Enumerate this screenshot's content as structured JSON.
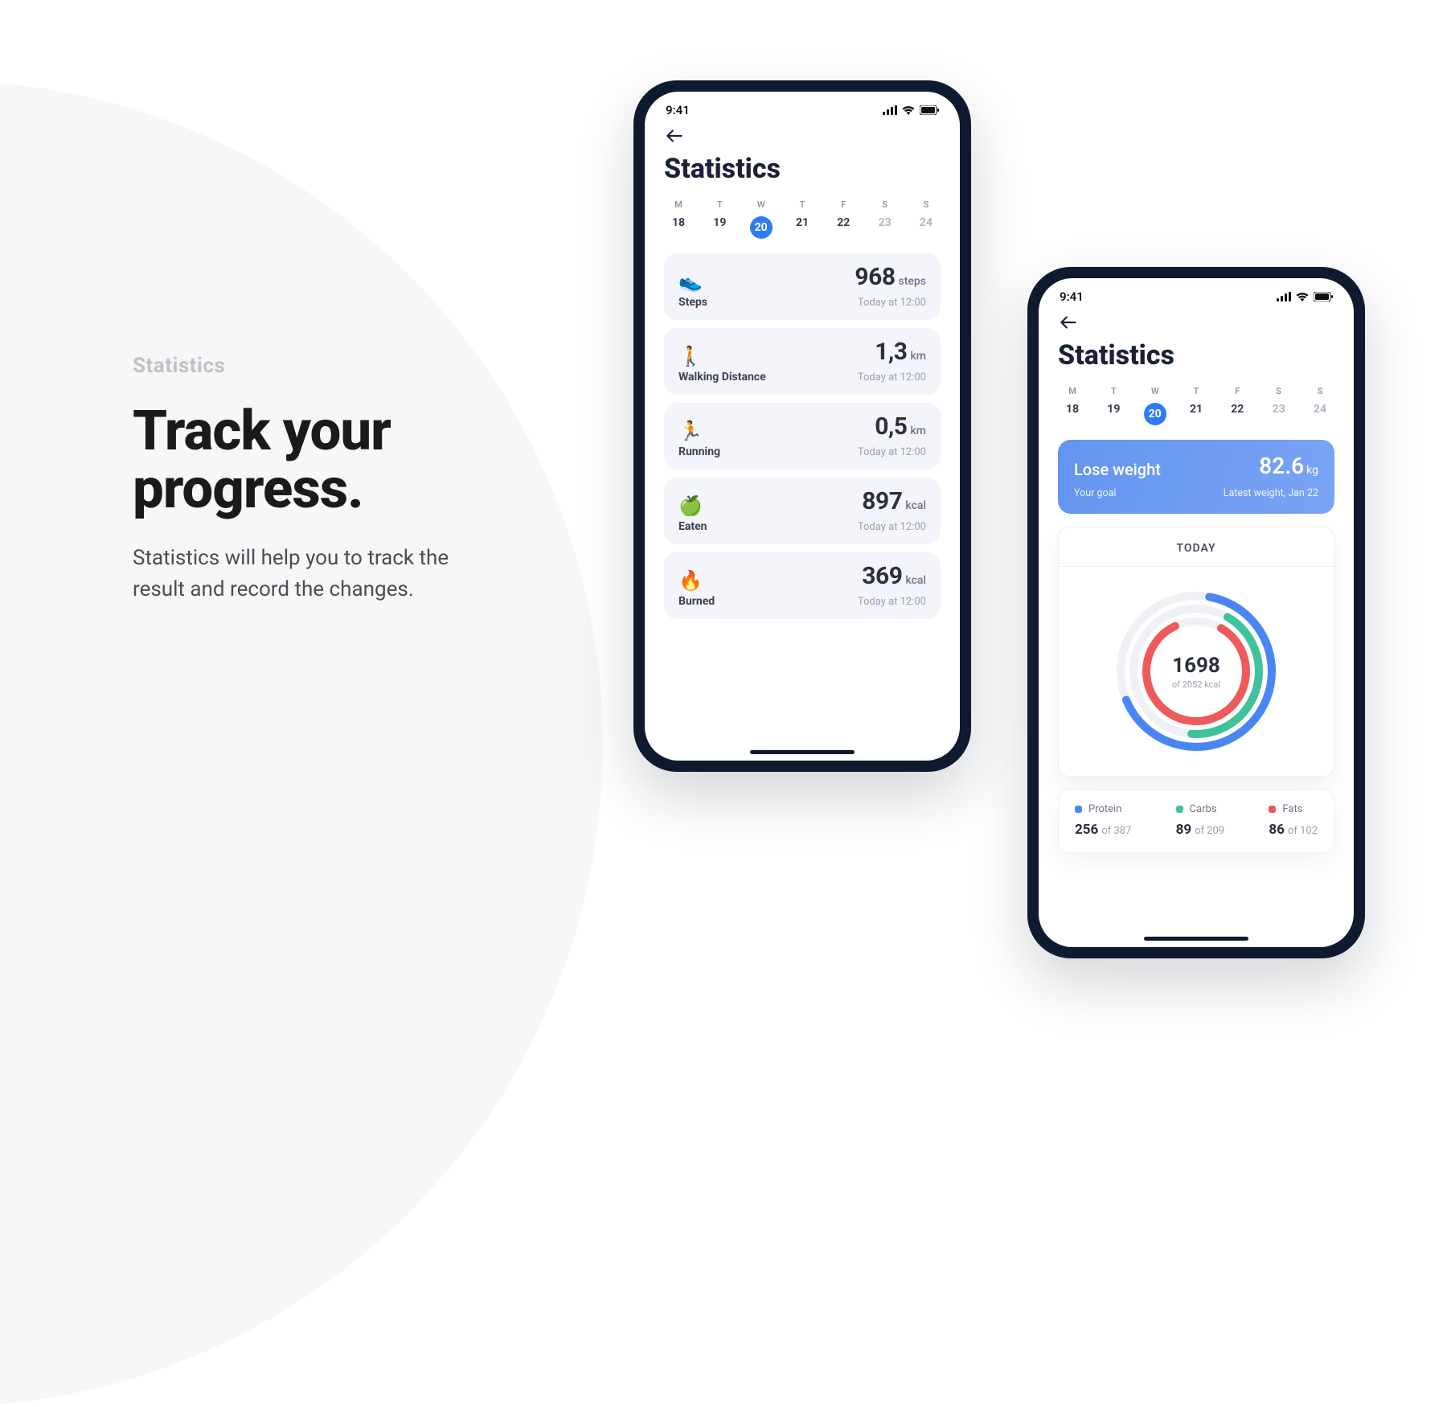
{
  "promo": {
    "eyebrow": "Statistics",
    "title": "Track your progress.",
    "desc": "Statistics will help you to track the result and record the changes."
  },
  "status_time": "9:41",
  "phone1": {
    "title": "Statistics",
    "days": [
      {
        "letter": "M",
        "num": "18"
      },
      {
        "letter": "T",
        "num": "19"
      },
      {
        "letter": "W",
        "num": "20",
        "selected": true
      },
      {
        "letter": "T",
        "num": "21"
      },
      {
        "letter": "F",
        "num": "22"
      },
      {
        "letter": "S",
        "num": "23",
        "dim": true
      },
      {
        "letter": "S",
        "num": "24",
        "dim": true
      }
    ],
    "stats": [
      {
        "icon": "👟",
        "label": "Steps",
        "value": "968",
        "unit": "steps",
        "time": "Today at 12:00"
      },
      {
        "icon": "🚶",
        "label": "Walking Distance",
        "value": "1,3",
        "unit": "km",
        "time": "Today at 12:00"
      },
      {
        "icon": "🏃",
        "label": "Running",
        "value": "0,5",
        "unit": "km",
        "time": "Today at 12:00"
      },
      {
        "icon": "🍏",
        "label": "Eaten",
        "value": "897",
        "unit": "kcal",
        "time": "Today at 12:00"
      },
      {
        "icon": "🔥",
        "label": "Burned",
        "value": "369",
        "unit": "kcal",
        "time": "Today at 12:00"
      }
    ]
  },
  "phone2": {
    "title": "Statistics",
    "days": [
      {
        "letter": "M",
        "num": "18"
      },
      {
        "letter": "T",
        "num": "19"
      },
      {
        "letter": "W",
        "num": "20",
        "selected": true
      },
      {
        "letter": "T",
        "num": "21"
      },
      {
        "letter": "F",
        "num": "22"
      },
      {
        "letter": "S",
        "num": "23",
        "dim": true
      },
      {
        "letter": "S",
        "num": "24",
        "dim": true
      }
    ],
    "goal": {
      "title": "Lose weight",
      "subtitle": "Your goal",
      "weight": "82.6",
      "unit": "kg",
      "meta": "Latest weight, Jan 22"
    },
    "today_label": "TODAY",
    "donut": {
      "value": "1698",
      "sub": "of 2052 kcal"
    },
    "macros": {
      "protein": {
        "label": "Protein",
        "val": "256",
        "of": "of 387"
      },
      "carbs": {
        "label": "Carbs",
        "val": "89",
        "of": "of 209"
      },
      "fats": {
        "label": "Fats",
        "val": "86",
        "of": "of 102"
      }
    }
  }
}
